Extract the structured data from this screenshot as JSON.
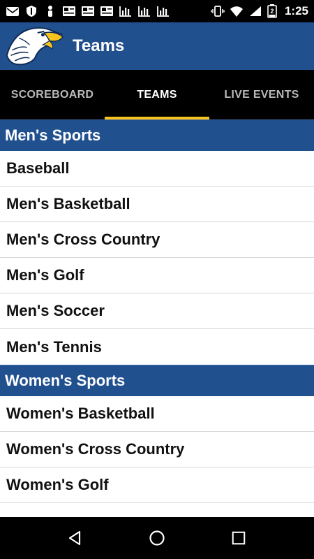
{
  "status_bar": {
    "time": "1:25",
    "battery_level": "2",
    "icons": [
      "mail-icon",
      "shield-icon",
      "person-icon",
      "news-icon",
      "news-icon",
      "news-icon",
      "chart-icon",
      "chart-icon",
      "chart-icon",
      "vibrate-icon",
      "wifi-icon",
      "signal-icon",
      "battery-icon"
    ]
  },
  "app_bar": {
    "title": "Teams",
    "logo": "eagle-logo"
  },
  "tabs": [
    {
      "label": "SCOREBOARD",
      "active": false
    },
    {
      "label": "TEAMS",
      "active": true
    },
    {
      "label": "LIVE EVENTS",
      "active": false
    }
  ],
  "colors": {
    "brand_blue": "#21508f",
    "tab_indicator": "#f6c21c",
    "status_bar": "#000000"
  },
  "sections": [
    {
      "title": "Men's Sports",
      "items": [
        "Baseball",
        "Men's Basketball",
        "Men's Cross Country",
        "Men's Golf",
        "Men's Soccer",
        "Men's Tennis"
      ]
    },
    {
      "title": "Women's Sports",
      "items": [
        "Women's Basketball",
        "Women's Cross Country",
        "Women's Golf"
      ]
    }
  ],
  "nav_bar": {
    "buttons": [
      "back-icon",
      "home-icon",
      "recents-icon"
    ]
  }
}
